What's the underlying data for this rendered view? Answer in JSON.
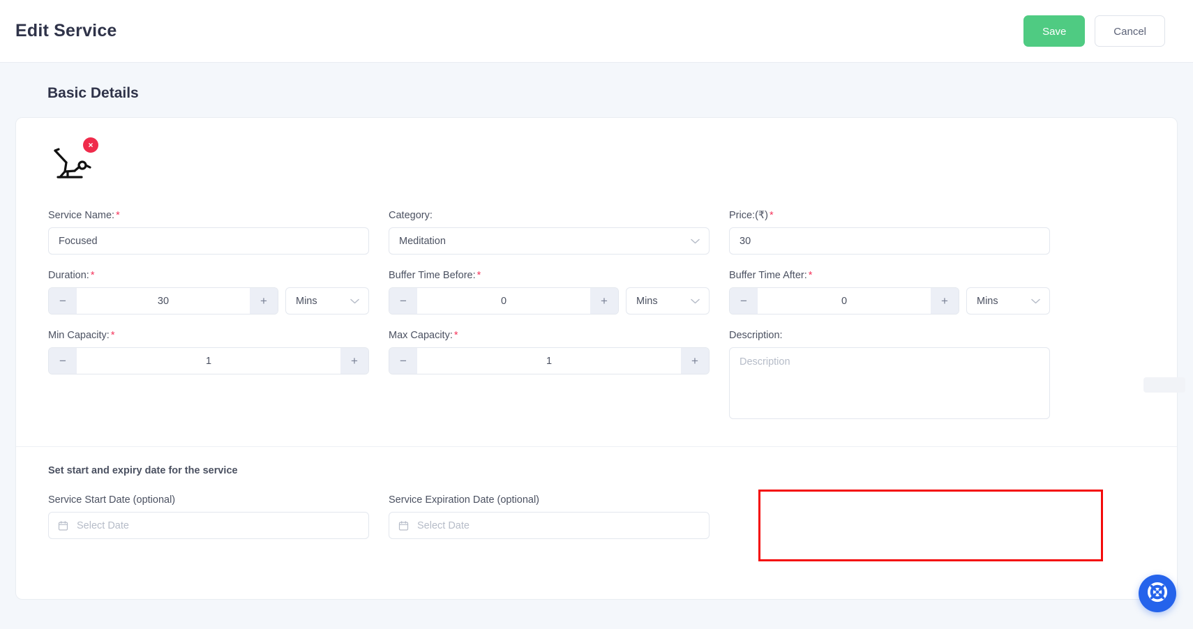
{
  "header": {
    "title": "Edit Service",
    "save_label": "Save",
    "cancel_label": "Cancel",
    "save_color": "#4fcb82"
  },
  "section": {
    "title": "Basic Details"
  },
  "thumbnail": {
    "icon": "exercise-pose-icon",
    "remove_label": "×"
  },
  "fields": {
    "service_name": {
      "label": "Service Name:",
      "required": "*",
      "value": "Focused"
    },
    "category": {
      "label": "Category:",
      "value": "Meditation",
      "chevron": "chevron-down-icon"
    },
    "price": {
      "label": "Price:(₹)",
      "required": "*",
      "value": "30"
    },
    "duration": {
      "label": "Duration:",
      "required": "*",
      "value": "30",
      "minus": "−",
      "plus": "+",
      "unit": "Mins"
    },
    "buffer_before": {
      "label": "Buffer Time Before:",
      "required": "*",
      "value": "0",
      "minus": "−",
      "plus": "+",
      "unit": "Mins"
    },
    "buffer_after": {
      "label": "Buffer Time After:",
      "required": "*",
      "value": "0",
      "minus": "−",
      "plus": "+",
      "unit": "Mins"
    },
    "min_capacity": {
      "label": "Min Capacity:",
      "required": "*",
      "value": "1",
      "minus": "−",
      "plus": "+"
    },
    "max_capacity": {
      "label": "Max Capacity:",
      "required": "*",
      "value": "1",
      "minus": "−",
      "plus": "+"
    },
    "description": {
      "label": "Description:",
      "placeholder": "Description",
      "value": ""
    }
  },
  "date_section": {
    "heading": "Set start and expiry date for the service",
    "start_date": {
      "label": "Service Start Date (optional)",
      "placeholder": "Select Date",
      "value": ""
    },
    "expiration_date": {
      "label": "Service Expiration Date (optional)",
      "placeholder": "Select Date",
      "value": ""
    },
    "highlight_color": "#f40b0b"
  },
  "support": {
    "icon": "lifebuoy-help-icon",
    "color": "#2563eb"
  }
}
